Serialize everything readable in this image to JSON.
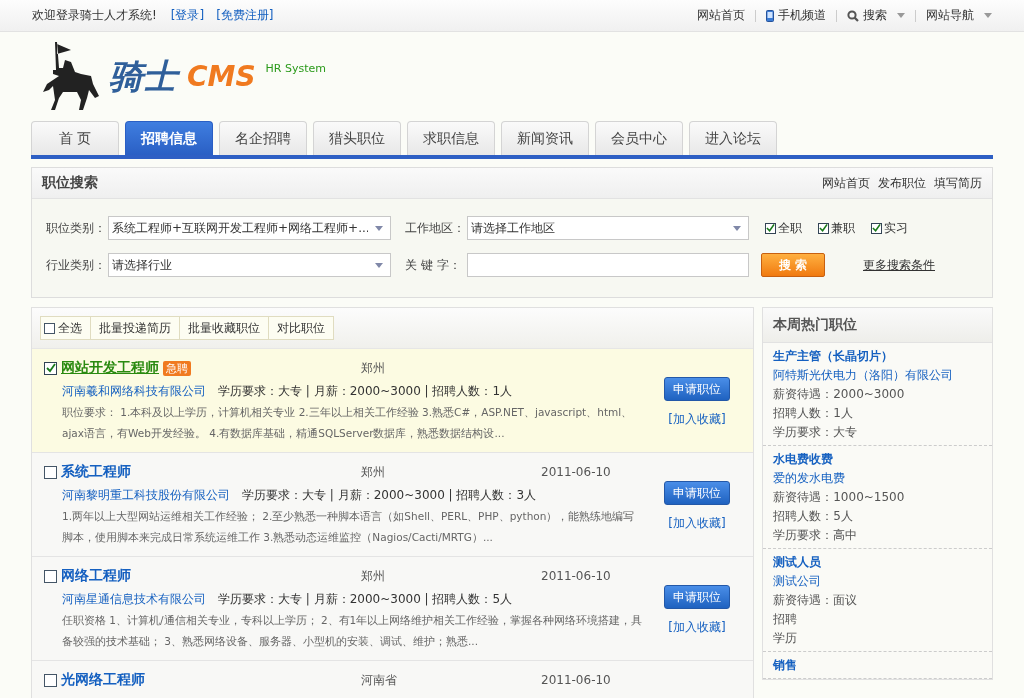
{
  "top_bar": {
    "welcome": "欢迎登录骑士人才系统!",
    "links": [
      "[登录]",
      "[免费注册]"
    ],
    "right_items": [
      {
        "label": "网站首页",
        "kind": "plain"
      },
      {
        "label": "手机频道",
        "kind": "phone"
      },
      {
        "label": "搜索",
        "kind": "search"
      },
      {
        "label": "网站导航",
        "kind": "dropdown"
      }
    ]
  },
  "logo": {
    "name": "骑士",
    "suffix": "CMS",
    "tagline": "HR System"
  },
  "nav_tabs": [
    {
      "label": "首 页",
      "selected": false
    },
    {
      "label": "招聘信息",
      "selected": true
    },
    {
      "label": "名企招聘",
      "selected": false
    },
    {
      "label": "猎头职位",
      "selected": false
    },
    {
      "label": "求职信息",
      "selected": false
    },
    {
      "label": "新闻资讯",
      "selected": false
    },
    {
      "label": "会员中心",
      "selected": false
    },
    {
      "label": "进入论坛",
      "selected": false
    }
  ],
  "search_panel": {
    "title": "职位搜索",
    "links": [
      "网站首页",
      "发布职位",
      "填写简历"
    ],
    "category": {
      "label": "职位类别：",
      "value": "系统工程师+互联网开发工程师+网络工程师+..."
    },
    "area": {
      "label": "工作地区：",
      "value": "请选择工作地区"
    },
    "industry": {
      "label": "行业类别：",
      "value": "请选择行业"
    },
    "keyword": {
      "label": "关 键 字："
    },
    "job_types": [
      {
        "label": "全职",
        "checked": true
      },
      {
        "label": "兼职",
        "checked": true
      },
      {
        "label": "实习",
        "checked": true
      }
    ],
    "search_button": "搜 索",
    "more_link": "更多搜索条件"
  },
  "toolbar": {
    "select_all": {
      "label": "全选",
      "checked": false
    },
    "actions": [
      "批量投递简历",
      "批量收藏职位",
      "对比职位"
    ]
  },
  "jobs": [
    {
      "title": "网站开发工程师",
      "badge": "急聘",
      "checked": true,
      "city": "郑州",
      "company": "河南羲和网络科技有限公司",
      "terms": "学历要求：大专  | 月薪：2000~3000 | 招聘人数：1人",
      "description": "职位要求： 1.本科及以上学历，计算机相关专业 2.三年以上相关工作经验 3.熟悉C#，ASP.NET、javascript、html、ajax语言，有Web开发经验。 4.有数据库基础，精通SQLServer数据库，熟悉数据结构设...",
      "apply": "申请职位",
      "favorite": "[加入收藏]"
    },
    {
      "title": "系统工程师",
      "checked": false,
      "city": "郑州",
      "date": "2011-06-10",
      "company": "河南黎明重工科技股份有限公司",
      "terms": "学历要求：大专  | 月薪：2000~3000 | 招聘人数：3人",
      "description": "1.两年以上大型网站运维相关工作经验； 2.至少熟悉一种脚本语言（如Shell、PERL、PHP、python），能熟练地编写脚本，使用脚本来完成日常系统运维工作 3.熟悉动态运维监控（Nagios/Cacti/MRTG）...",
      "apply": "申请职位",
      "favorite": "[加入收藏]"
    },
    {
      "title": "网络工程师",
      "checked": false,
      "city": "郑州",
      "date": "2011-06-10",
      "company": "河南星通信息技术有限公司",
      "terms": "学历要求：大专  | 月薪：2000~3000 | 招聘人数：5人",
      "description": "任职资格 1、计算机/通信相关专业，专科以上学历； 2、有1年以上网络维护相关工作经验，掌握各种网络环境搭建，具备较强的技术基础； 3、熟悉网络设备、服务器、小型机的安装、调试、维护；熟悉...",
      "apply": "申请职位",
      "favorite": "[加入收藏]"
    },
    {
      "title": "光网络工程师",
      "checked": false,
      "city": "河南省",
      "date": "2011-06-10"
    }
  ],
  "hot_jobs": {
    "title": "本周热门职位",
    "items": [
      {
        "title": "生产主管（长晶切片）",
        "company": "阿特斯光伏电力（洛阳）有限公司",
        "lines": [
          "薪资待遇：2000~3000",
          "招聘人数：1人",
          "学历要求：大专"
        ]
      },
      {
        "title": "水电费收费",
        "company": "爱的发水电费",
        "lines": [
          "薪资待遇：1000~1500",
          "招聘人数：5人",
          "学历要求：高中"
        ]
      },
      {
        "title": "测试人员",
        "company": "测试公司",
        "lines": [
          "薪资待遇：面议",
          "招聘",
          "学历"
        ]
      },
      {
        "title": "销售"
      }
    ]
  }
}
